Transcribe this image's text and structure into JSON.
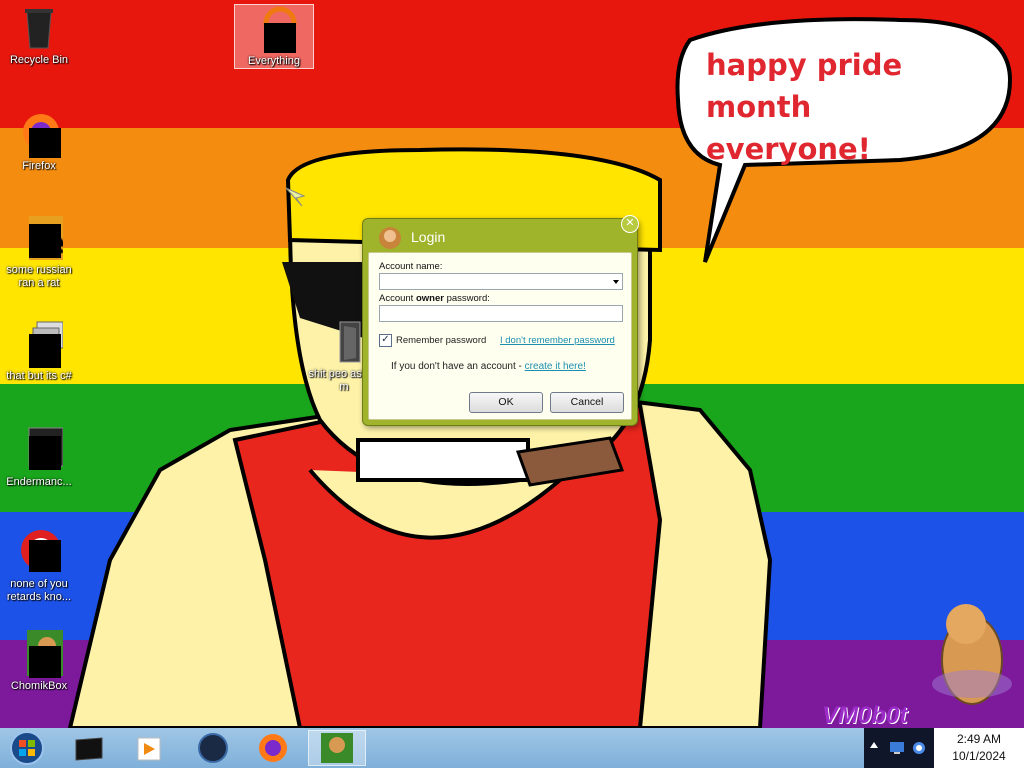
{
  "desktop": {
    "icons": [
      {
        "label": "Recycle Bin"
      },
      {
        "label": "Everything"
      },
      {
        "label": "Firefox"
      },
      {
        "label": "some russian ran a rat"
      },
      {
        "label": "that but its c#"
      },
      {
        "label": "Endermanc..."
      },
      {
        "label": "none of you retards kno..."
      },
      {
        "label": "ChomikBox"
      },
      {
        "label": "shit peo asked m"
      }
    ],
    "speech_bubble": {
      "line1": "happy pride month",
      "line2": "everyone!"
    },
    "signature": "VM0b0t"
  },
  "dialog": {
    "title": "Login",
    "account_name_label": "Account name:",
    "account_name_value": "",
    "password_label_prefix": "Account ",
    "password_label_bold": "owner",
    "password_label_suffix": " password:",
    "password_value": "",
    "remember_label": "Remember password",
    "remember_checked": true,
    "forgot_link": "I don't remember password",
    "no_account_text": "If you don't have an account - ",
    "create_link": "create it here!",
    "ok_label": "OK",
    "cancel_label": "Cancel"
  },
  "taskbar": {
    "pinned": [
      "start-orb-icon",
      "terminal-icon",
      "media-player-icon",
      "globe-icon",
      "firefox-icon",
      "chomikbox-icon"
    ]
  },
  "clock": {
    "time": "2:49 AM",
    "date": "10/1/2024"
  }
}
